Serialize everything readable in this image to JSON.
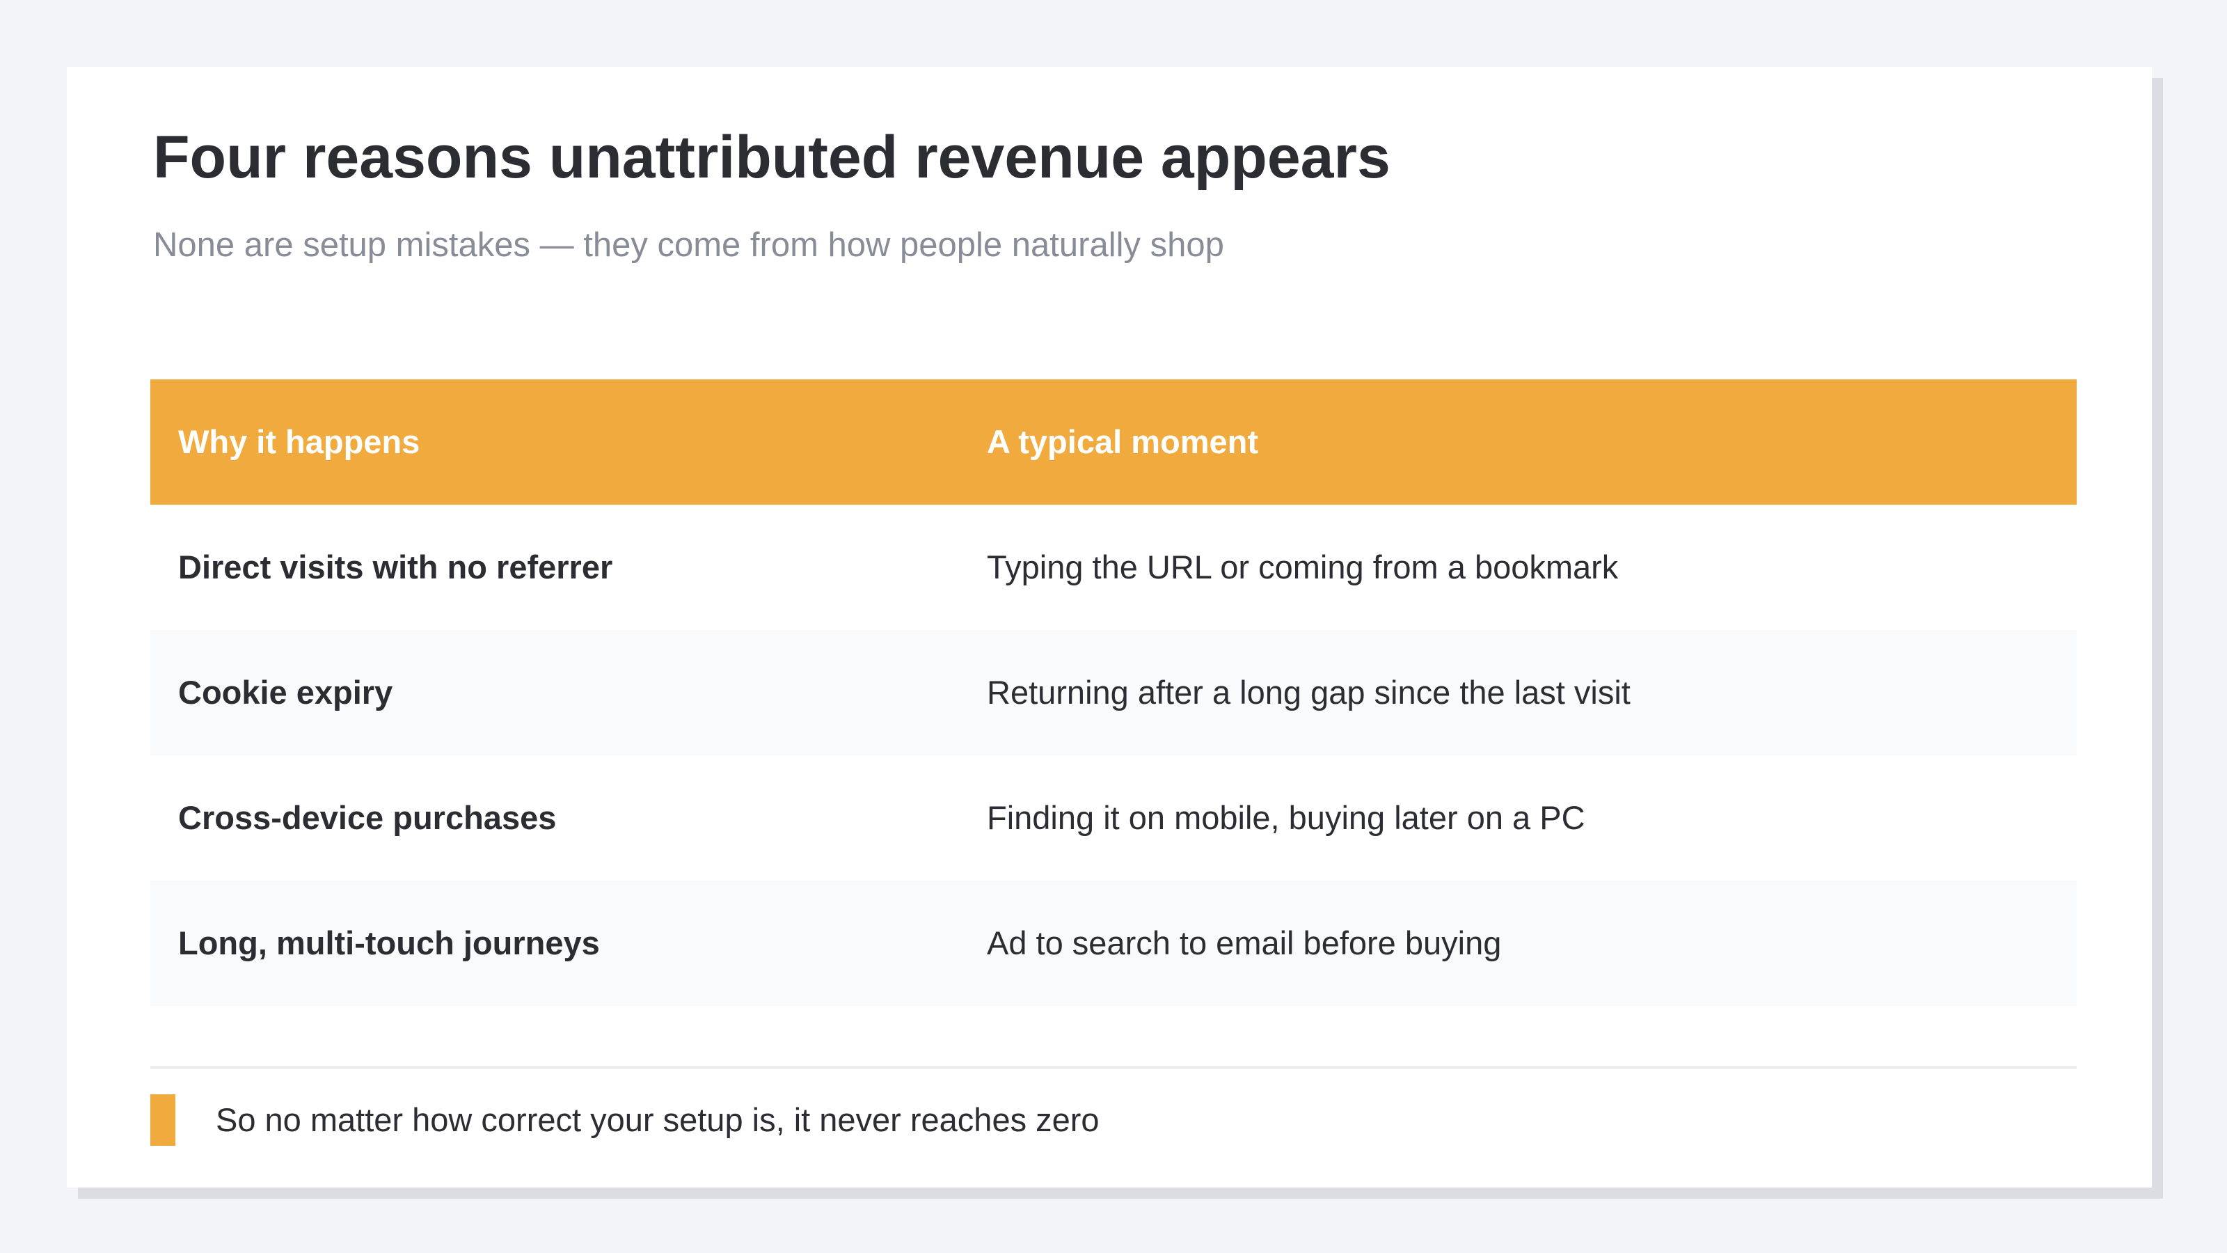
{
  "slide": {
    "title": "Four reasons unattributed revenue appears",
    "subtitle": "None are setup mistakes — they come from how people naturally shop"
  },
  "table": {
    "headers": [
      "Why it happens",
      "A typical moment"
    ],
    "rows": [
      [
        "Direct visits with no referrer",
        "Typing the URL or coming from a bookmark"
      ],
      [
        "Cookie expiry",
        "Returning after a long gap since the last visit"
      ],
      [
        "Cross-device purchases",
        "Finding it on mobile, buying later on a PC"
      ],
      [
        "Long, multi-touch journeys",
        "Ad to search to email before buying"
      ]
    ]
  },
  "note": {
    "text": "So no matter how correct your setup is, it never reaches zero"
  },
  "colors": {
    "accent": "#f0aa3d",
    "background": "#f3f4f8",
    "card": "#ffffff",
    "text": "#2b2d33",
    "muted": "#878c97",
    "row_alt": "#f9fafc"
  }
}
